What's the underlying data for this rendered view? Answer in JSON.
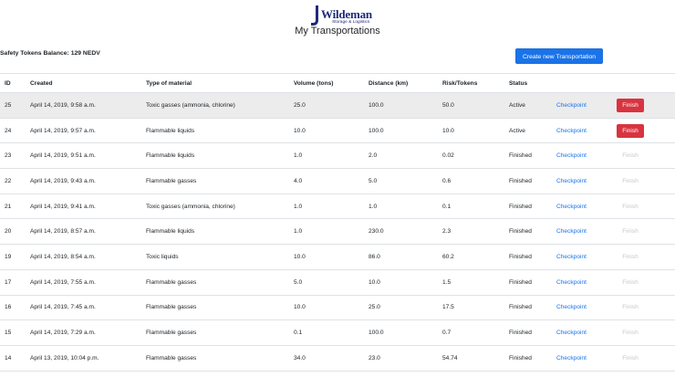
{
  "logo": {
    "word": "Wildeman",
    "tagline": "Storage & Logistics"
  },
  "page_title": "My Transportations",
  "balance": {
    "label": "Safety Tokens Balance:",
    "value": "129 NEDV"
  },
  "create_button": "Create new Transportation",
  "columns": [
    "ID",
    "Created",
    "Type of material",
    "Volume (tons)",
    "Distance (km)",
    "Risk/Tokens",
    "Status"
  ],
  "checkpoint_label": "Checkpoint",
  "finish_label": "Finish",
  "rows": [
    {
      "id": "25",
      "created": "April 14, 2019, 9:58 a.m.",
      "type": "Toxic gasses (ammonia, chlorine)",
      "volume": "25.0",
      "distance": "100.0",
      "risk": "50.0",
      "status": "Active"
    },
    {
      "id": "24",
      "created": "April 14, 2019, 9:57 a.m.",
      "type": "Flammable liquids",
      "volume": "10.0",
      "distance": "100.0",
      "risk": "10.0",
      "status": "Active"
    },
    {
      "id": "23",
      "created": "April 14, 2019, 9:51 a.m.",
      "type": "Flammable liquids",
      "volume": "1.0",
      "distance": "2.0",
      "risk": "0.02",
      "status": "Finished"
    },
    {
      "id": "22",
      "created": "April 14, 2019, 9:43 a.m.",
      "type": "Flammable gasses",
      "volume": "4.0",
      "distance": "5.0",
      "risk": "0.6",
      "status": "Finished"
    },
    {
      "id": "21",
      "created": "April 14, 2019, 9:41 a.m.",
      "type": "Toxic gasses (ammonia, chlorine)",
      "volume": "1.0",
      "distance": "1.0",
      "risk": "0.1",
      "status": "Finished"
    },
    {
      "id": "20",
      "created": "April 14, 2019, 8:57 a.m.",
      "type": "Flammable liquids",
      "volume": "1.0",
      "distance": "230.0",
      "risk": "2.3",
      "status": "Finished"
    },
    {
      "id": "19",
      "created": "April 14, 2019, 8:54 a.m.",
      "type": "Toxic liquids",
      "volume": "10.0",
      "distance": "86.0",
      "risk": "60.2",
      "status": "Finished"
    },
    {
      "id": "17",
      "created": "April 14, 2019, 7:55 a.m.",
      "type": "Flammable gasses",
      "volume": "5.0",
      "distance": "10.0",
      "risk": "1.5",
      "status": "Finished"
    },
    {
      "id": "16",
      "created": "April 14, 2019, 7:45 a.m.",
      "type": "Flammable gasses",
      "volume": "10.0",
      "distance": "25.0",
      "risk": "17.5",
      "status": "Finished"
    },
    {
      "id": "15",
      "created": "April 14, 2019, 7:29 a.m.",
      "type": "Flammable gasses",
      "volume": "0.1",
      "distance": "100.0",
      "risk": "0.7",
      "status": "Finished"
    },
    {
      "id": "14",
      "created": "April 13, 2019, 10:04 p.m.",
      "type": "Flammable gasses",
      "volume": "34.0",
      "distance": "23.0",
      "risk": "54.74",
      "status": "Finished"
    }
  ],
  "colors": {
    "accent": "#1a73e8",
    "danger": "#d9333f",
    "logo": "#1e2a78"
  }
}
